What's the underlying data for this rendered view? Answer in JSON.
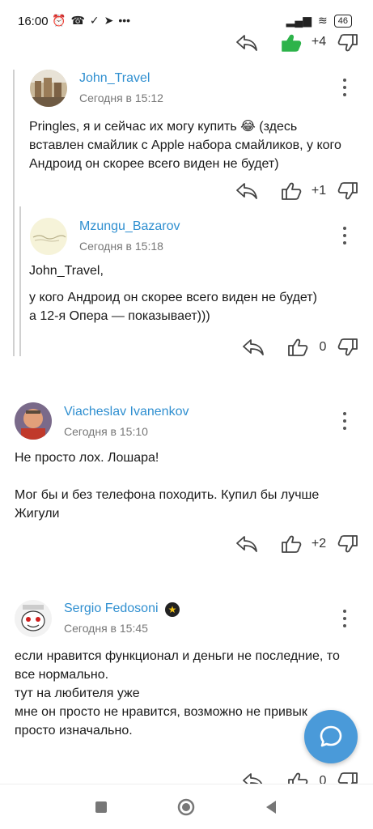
{
  "status": {
    "time": "16:00",
    "battery": "46"
  },
  "top_actions": {
    "count": "+4"
  },
  "comments": [
    {
      "author": "John_Travel",
      "date": "Сегодня в 15:12",
      "lines": [
        "Pringles, я и сейчас их могу купить 😂 (здесь",
        "вставлен смайлик с Apple набора смайликов, у кого",
        "Андроид он скорее всего виден не будет)"
      ],
      "count": "+1"
    },
    {
      "author": "Mzungu_Bazarov",
      "date": "Сегодня в 15:18",
      "lines": [
        "John_Travel,",
        "",
        "у кого Андроид он скорее всего виден не будет)",
        "а 12-я Опера — показывает)))"
      ],
      "count": "0"
    },
    {
      "author": "Viacheslav Ivanenkov",
      "date": "Сегодня в 15:10",
      "lines": [
        "Не просто лох. Лошара!",
        "",
        "Мог бы и без телефона походить. Купил бы лучше",
        "Жигули"
      ],
      "count": "+2"
    },
    {
      "author": "Sergio Fedosoni",
      "date": "Сегодня в 15:45",
      "lines": [
        "если нравится функционал и деньги не последние, то",
        "все нормально.",
        "тут на любителя уже",
        "мне он просто не нравится, возможно не привык",
        "просто изначально."
      ],
      "count": "0"
    }
  ],
  "icons": {
    "reply": "reply-icon",
    "like": "thumbs-up-icon",
    "dislike": "thumbs-down-icon",
    "more": "more-vertical-icon",
    "chat": "chat-bubble-icon",
    "badge": "star-badge-icon"
  },
  "colors": {
    "author": "#2f8fd0",
    "like_active": "#2db34a",
    "fab": "#4a9ad9"
  }
}
